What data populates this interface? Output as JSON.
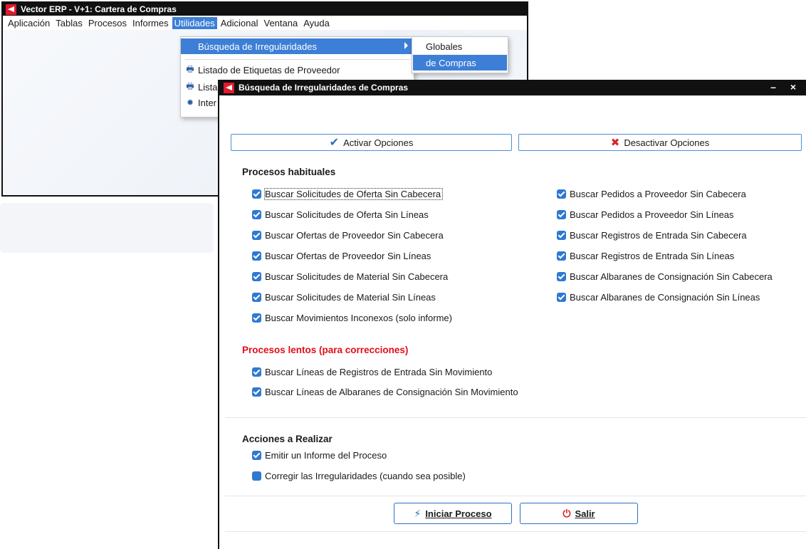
{
  "main_window": {
    "title": "Vector ERP - V+1: Cartera de Compras",
    "menu": [
      "Aplicación",
      "Tablas",
      "Procesos",
      "Informes",
      "Utilidades",
      "Adicional",
      "Ventana",
      "Ayuda"
    ],
    "active_menu": "Utilidades"
  },
  "dropdown": {
    "busqueda": "Búsqueda de Irregularidades",
    "listado_etiquetas": "Listado de Etiquetas de Proveedor",
    "listado_truncated": "Listad",
    "inter_truncated": "Inter"
  },
  "submenu": {
    "globales": "Globales",
    "de_compras": "de Compras"
  },
  "dialog": {
    "title": "Búsqueda de Irregularidades de Compras",
    "window_controls": "– ×",
    "activar": "Activar Opciones",
    "desactivar": "Desactivar Opciones",
    "habituales_title": "Procesos habituales",
    "habituales_left": [
      "Buscar Solicitudes de Oferta Sin Cabecera",
      "Buscar Solicitudes de Oferta Sin Líneas",
      "Buscar Ofertas de Proveedor Sin Cabecera",
      "Buscar Ofertas de Proveedor Sin Líneas",
      "Buscar Solicitudes de Material Sin Cabecera",
      "Buscar Solicitudes de Material Sin Líneas",
      "Buscar Movimientos Inconexos (solo informe)"
    ],
    "habituales_right": [
      "Buscar Pedidos a Proveedor Sin Cabecera",
      "Buscar Pedidos a Proveedor Sin Líneas",
      "Buscar Registros de Entrada Sin Cabecera",
      "Buscar Registros de Entrada Sin Líneas",
      "Buscar Albaranes de Consignación Sin Cabecera",
      "Buscar Albaranes de Consignación Sin Líneas"
    ],
    "lentos_title": "Procesos lentos (para correcciones)",
    "lentos": [
      "Buscar Líneas de Registros de Entrada Sin Movimiento",
      "Buscar Líneas de Albaranes de Consignación Sin Movimiento"
    ],
    "acciones_title": "Acciones a Realizar",
    "acciones": [
      {
        "label": "Emitir un Informe del Proceso",
        "checked": true
      },
      {
        "label": "Corregir las Irregularidades (cuando sea posible)",
        "checked": false
      }
    ],
    "iniciar": "Iniciar Proceso",
    "salir": "Salir"
  },
  "colors": {
    "accent": "#3d7fd6",
    "checkbox": "#2f79d1",
    "brand_red": "#e21a2c",
    "section_red": "#e10e18"
  },
  "icons": [
    "logo-icon",
    "printer-icon",
    "gear-icon",
    "check-icon",
    "x-icon",
    "bolt-icon",
    "power-icon",
    "submenu-arrow-icon"
  ]
}
